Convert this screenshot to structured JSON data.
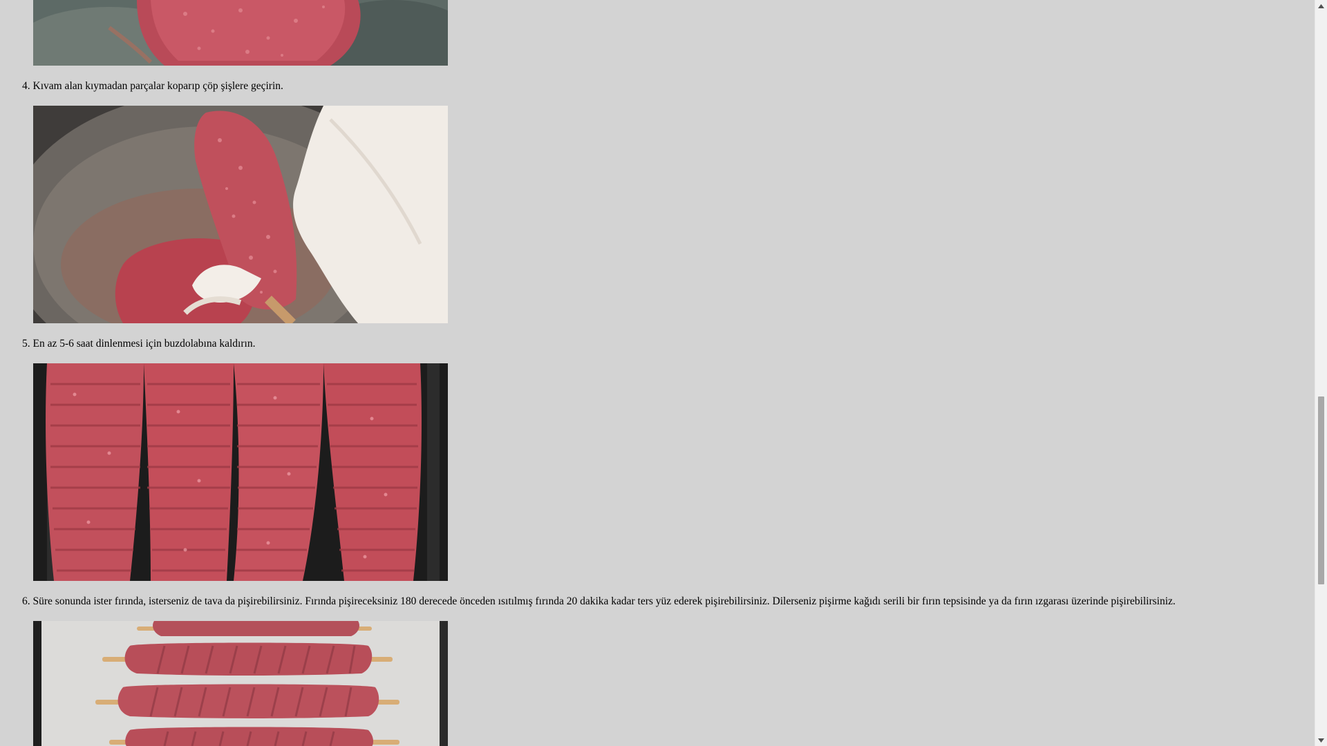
{
  "steps": [
    {
      "number": "4.",
      "text": "Kıvam alan kıymadan parçalar koparıp çöp şişlere geçirin."
    },
    {
      "number": "5.",
      "text": "En az 5-6 saat dinlenmesi için buzdolabına kaldırın."
    },
    {
      "number": "6.",
      "text": "Süre sonunda ister fırında, isterseniz de tava da pişirebilirsiniz. Fırında pişireceksiniz 180 derecede önceden ısıtılmış fırında 20 dakika kadar ters yüz ederek pişirebilirsiniz. Dilerseniz pişirme kağıdı serili bir fırın tepsisinde ya da fırın ızgarası üzerinde pişirebilirsiniz."
    }
  ],
  "photos": [
    {
      "name": "minced-meat-in-bowl-photo"
    },
    {
      "name": "shaping-kebab-on-skewer-photo"
    },
    {
      "name": "kebabs-on-grill-pan-photo"
    },
    {
      "name": "kebabs-on-baking-paper-photo"
    }
  ],
  "icons": {
    "scroll_up": "chevron-up-icon",
    "scroll_down": "chevron-down-icon"
  },
  "colors": {
    "page_background": "#d3d3d3",
    "scrollbar_track": "#f1f1f1",
    "scrollbar_thumb": "#a8a8a8"
  }
}
